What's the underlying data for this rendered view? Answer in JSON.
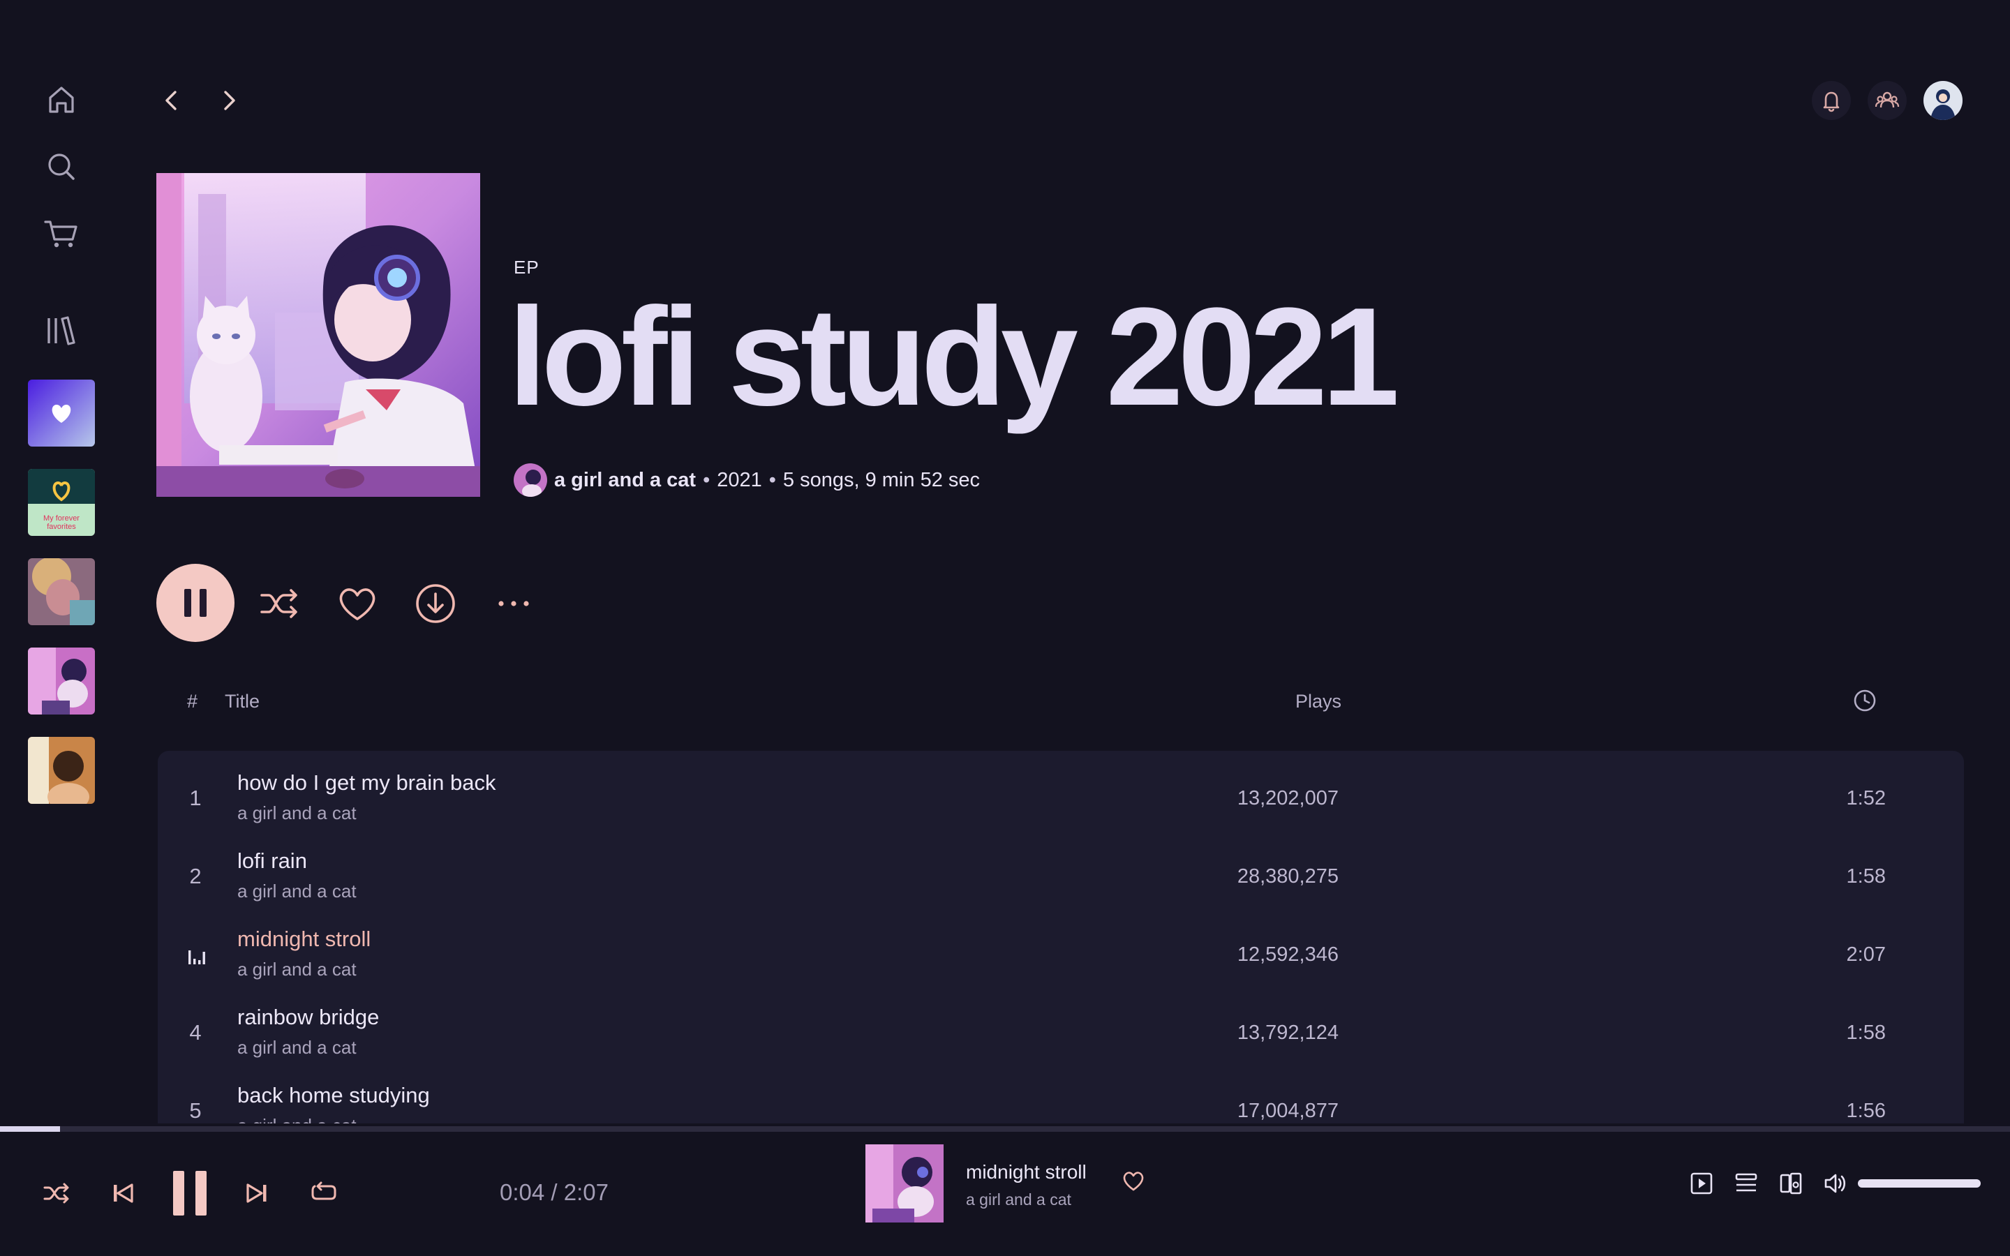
{
  "colors": {
    "background": "#13121f",
    "accent": "#f4c9c4",
    "playing_title": "#f0b8b0",
    "panel": "#1c1b2e"
  },
  "sidebar": {
    "icons": [
      "home-icon",
      "search-icon",
      "cart-icon",
      "library-icon"
    ],
    "playlists": [
      {
        "name": "liked-songs",
        "icon": "heart-icon"
      },
      {
        "name": "my-forever-favorites",
        "label": "My forever favorites"
      },
      {
        "name": "anime-girl-playlist"
      },
      {
        "name": "lofi-study-2021"
      },
      {
        "name": "warm-portrait-playlist"
      }
    ]
  },
  "album": {
    "type": "EP",
    "title": "lofi study 2021",
    "artist": "a girl and a cat",
    "year": "2021",
    "summary": "5 songs, 9 min 52 sec"
  },
  "table": {
    "col_num": "#",
    "col_title": "Title",
    "col_plays": "Plays",
    "tracks": [
      {
        "num": "1",
        "title": "how do I get my brain back",
        "artist": "a girl and a cat",
        "plays": "13,202,007",
        "duration": "1:52",
        "playing": false
      },
      {
        "num": "2",
        "title": "lofi rain",
        "artist": "a girl and a cat",
        "plays": "28,380,275",
        "duration": "1:58",
        "playing": false
      },
      {
        "num": "3",
        "title": "midnight stroll",
        "artist": "a girl and a cat",
        "plays": "12,592,346",
        "duration": "2:07",
        "playing": true
      },
      {
        "num": "4",
        "title": "rainbow bridge",
        "artist": "a girl and a cat",
        "plays": "13,792,124",
        "duration": "1:58",
        "playing": false
      },
      {
        "num": "5",
        "title": "back home studying",
        "artist": "a girl and a cat",
        "plays": "17,004,877",
        "duration": "1:56",
        "playing": false
      }
    ]
  },
  "player": {
    "time": "0:04 / 2:07",
    "progress_fraction": 0.03,
    "now_playing_title": "midnight stroll",
    "now_playing_artist": "a girl and a cat",
    "volume_fraction": 1.0
  }
}
